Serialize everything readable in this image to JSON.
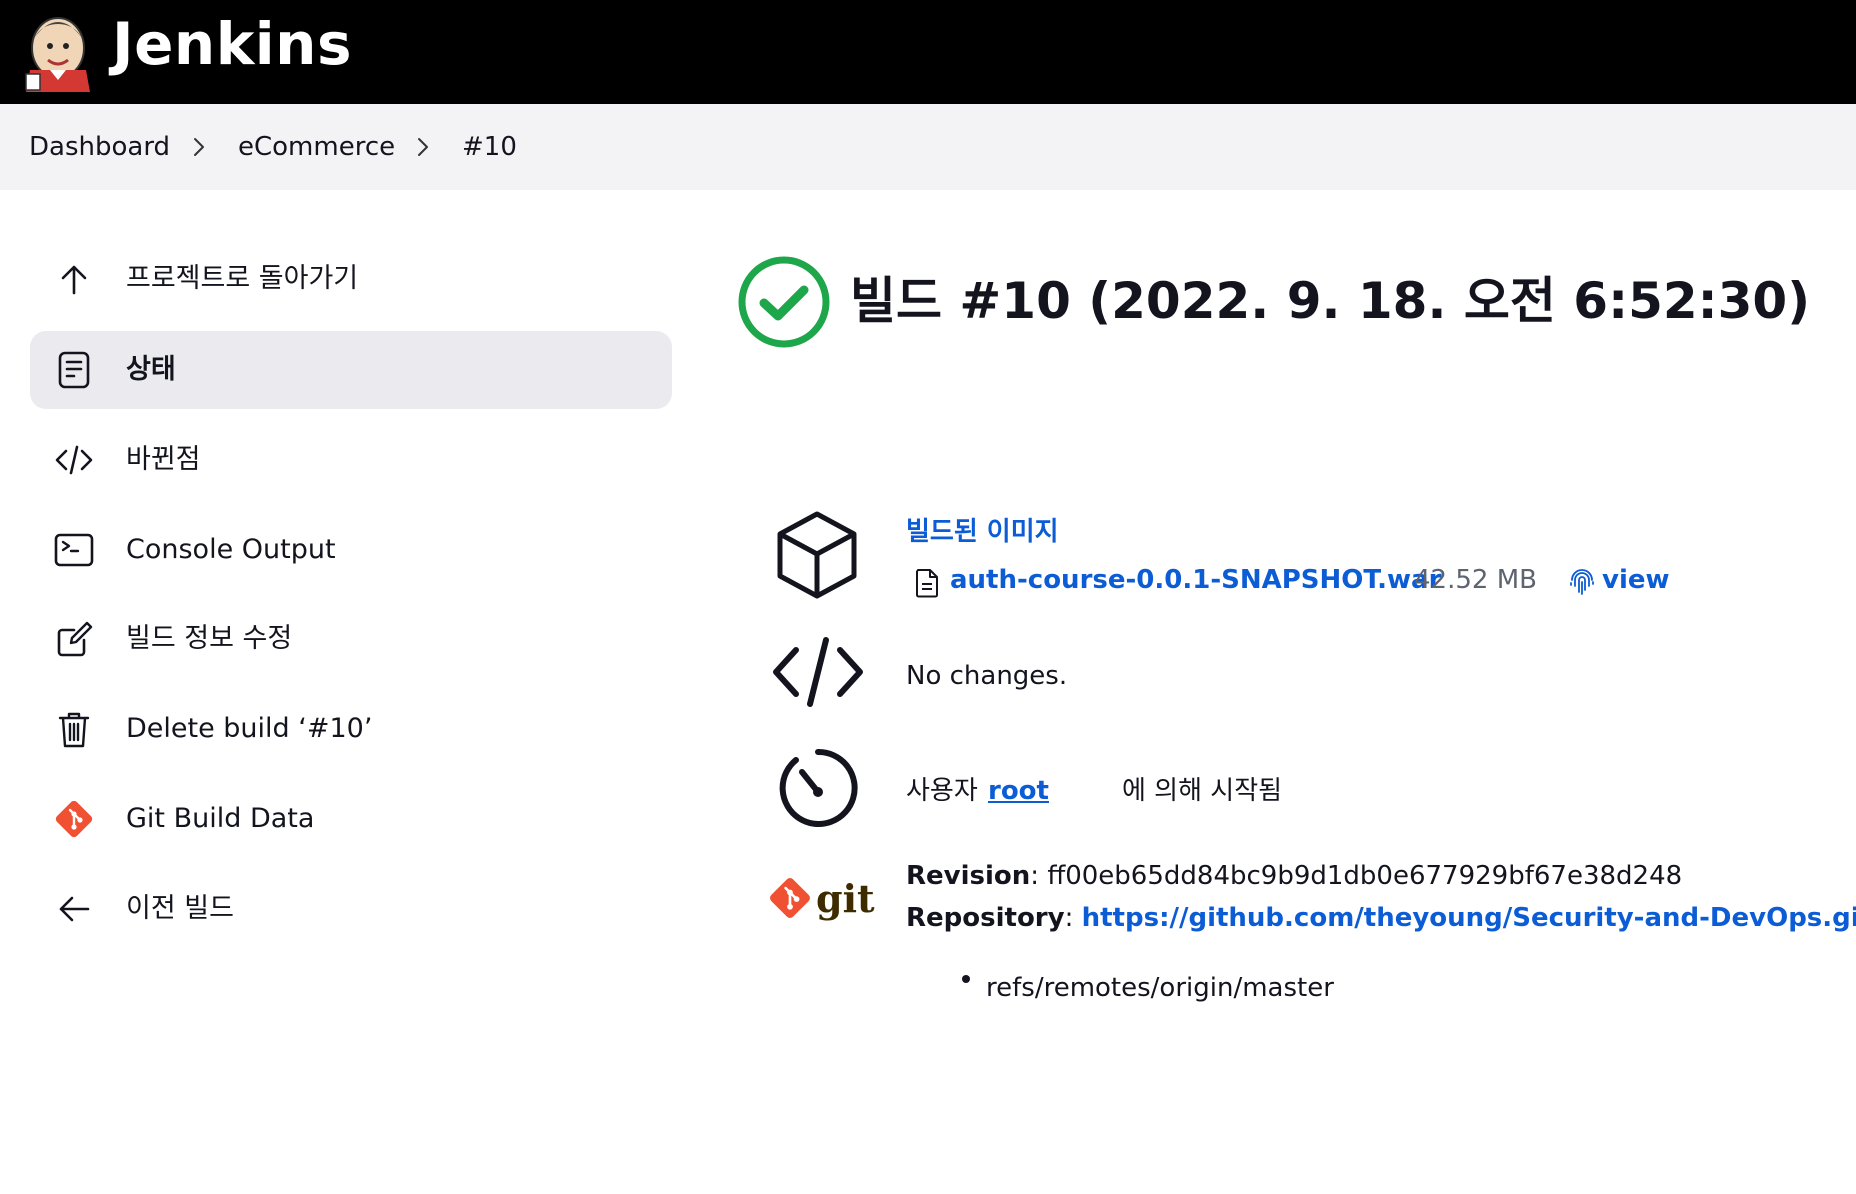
{
  "header": {
    "title": "Jenkins",
    "logo_icon": "jenkins-butler-logo"
  },
  "breadcrumb": {
    "items": [
      "Dashboard",
      "eCommerce",
      "#10"
    ],
    "separator_icon": "chevron-right-icon"
  },
  "sidebar": {
    "items": [
      {
        "label": "프로젝트로 돌아가기",
        "icon": "arrow-up-icon"
      },
      {
        "label": "상태",
        "icon": "document-icon",
        "active": true
      },
      {
        "label": "바뀐점",
        "icon": "code-icon"
      },
      {
        "label": "Console Output",
        "icon": "terminal-icon"
      },
      {
        "label": "빌드 정보 수정",
        "icon": "edit-icon"
      },
      {
        "label": "Delete build ‘#10’",
        "icon": "trash-icon"
      },
      {
        "label": "Git Build Data",
        "icon": "git-icon"
      },
      {
        "label": "이전 빌드",
        "icon": "arrow-left-icon"
      }
    ]
  },
  "main": {
    "title": "빌드 #10 (2022. 9. 18. 오전 6:52:30)",
    "status_icon": "success-check-icon",
    "status_color": "#1ea64b",
    "artifacts": {
      "heading": "빌드된 이미지",
      "file_name": "auth-course-0.0.1-SNAPSHOT.war",
      "file_size": "42.52 MB",
      "view_label": "view"
    },
    "changes": {
      "text": "No changes."
    },
    "started_by": {
      "prefix": "사용자",
      "user": "root",
      "suffix": "에 의해 시작됨"
    },
    "git": {
      "logo_text": "git",
      "revision_label": "Revision",
      "revision": "ff00eb65dd84bc9b9d1db0e677929bf67e38d248",
      "repository_label": "Repository",
      "repository": "https://github.com/theyoung/Security-and-DevOps.git",
      "branches": [
        "refs/remotes/origin/master"
      ]
    }
  },
  "colors": {
    "link": "#0b5cd5",
    "git_brand": "#f05133",
    "active_bg": "#ebebef"
  }
}
